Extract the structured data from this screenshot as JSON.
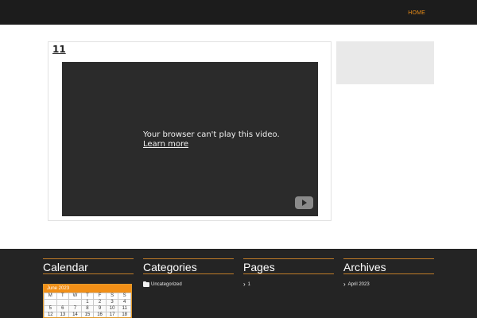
{
  "nav": {
    "home_label": "HOME"
  },
  "post": {
    "title": "11"
  },
  "video": {
    "message": "Your browser can't play this video.",
    "learn_more": "Learn more"
  },
  "footer": {
    "calendar": {
      "title": "Calendar",
      "caption": "June 2023",
      "weekdays": [
        "M",
        "T",
        "W",
        "T",
        "F",
        "S",
        "S"
      ],
      "weeks": [
        [
          "",
          "",
          "",
          "1",
          "2",
          "3",
          "4"
        ],
        [
          "5",
          "6",
          "7",
          "8",
          "9",
          "10",
          "11"
        ],
        [
          "12",
          "13",
          "14",
          "15",
          "16",
          "17",
          "18"
        ]
      ]
    },
    "categories": {
      "title": "Categories",
      "items": [
        "Uncategorized"
      ]
    },
    "pages": {
      "title": "Pages",
      "items": [
        "1"
      ]
    },
    "archives": {
      "title": "Archives",
      "items": [
        "April 2023"
      ]
    }
  },
  "colors": {
    "accent": "#e68a17",
    "topbar": "#1c1c1c",
    "footer": "#242424"
  },
  "icons": {
    "folder": "folder-icon",
    "chevron": "chevron-right-icon",
    "youtube": "youtube-icon"
  }
}
